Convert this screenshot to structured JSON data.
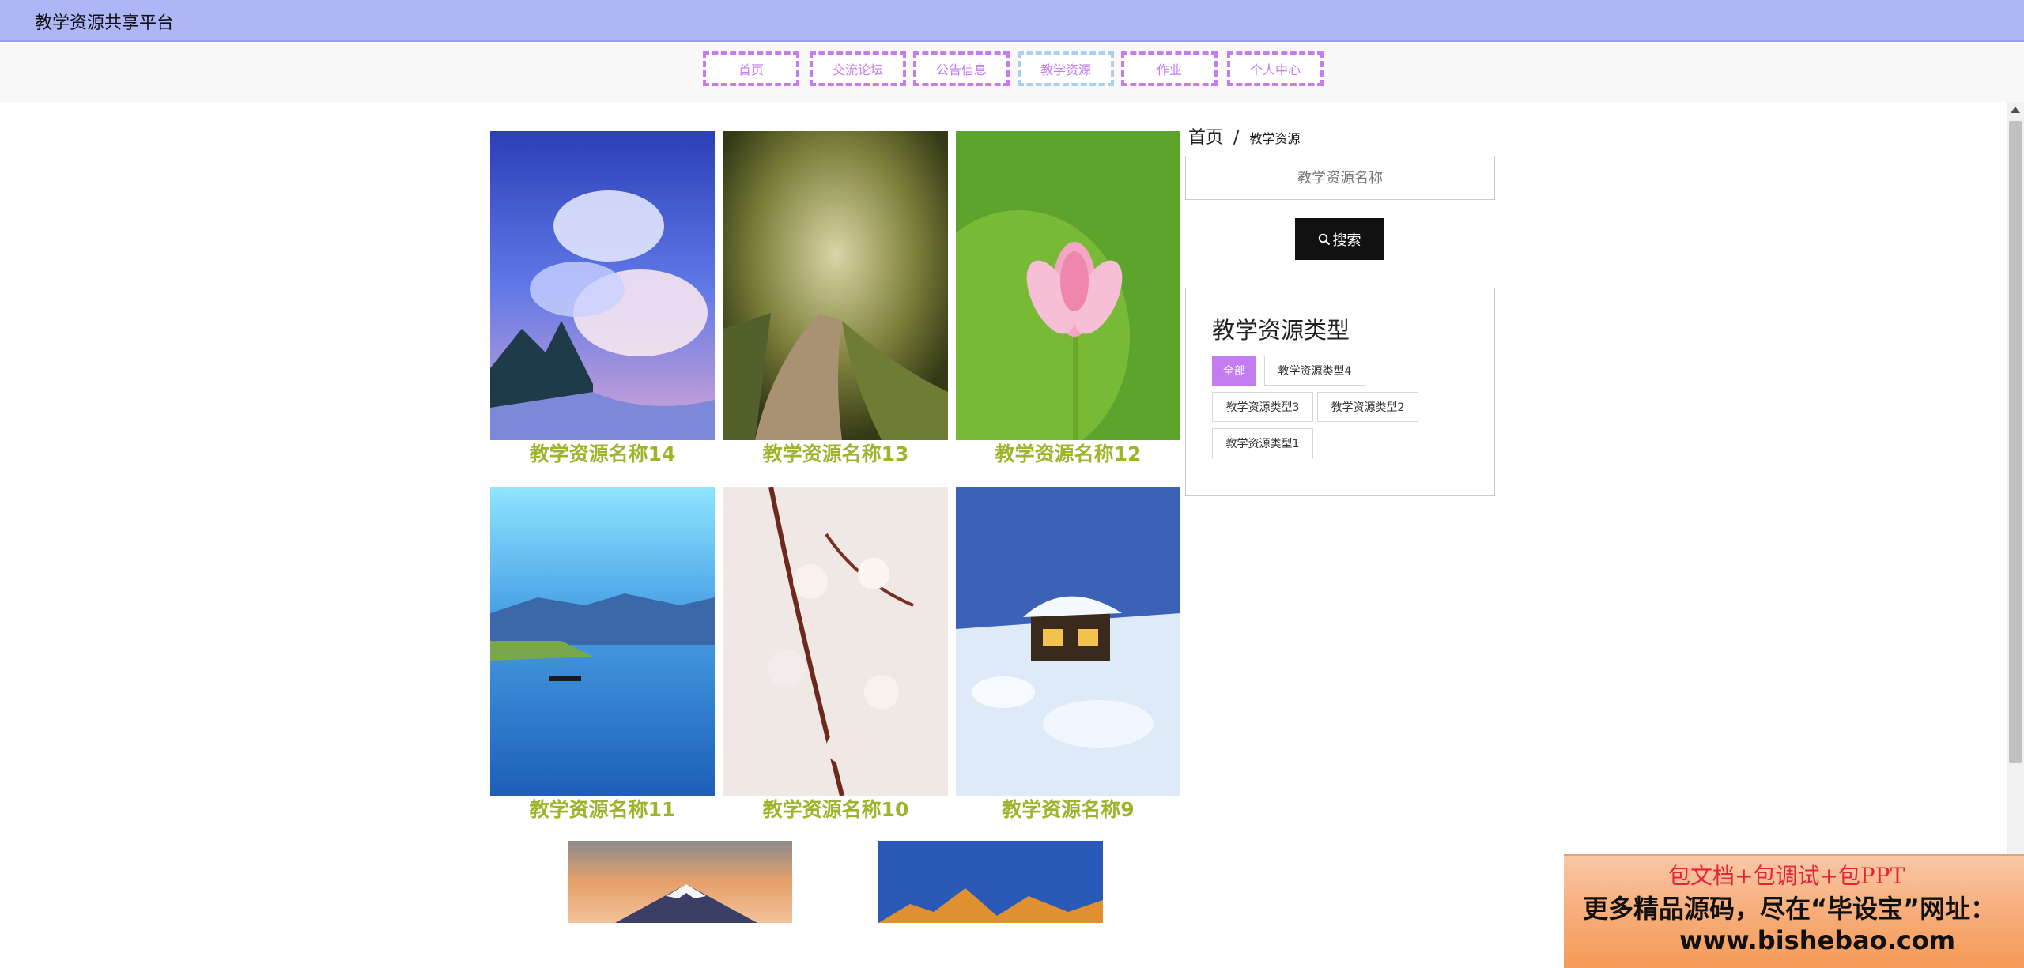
{
  "app": {
    "title": "教学资源共享平台"
  },
  "nav": {
    "items": [
      {
        "label": "首页"
      },
      {
        "label": "交流论坛"
      },
      {
        "label": "公告信息"
      },
      {
        "label": "教学资源"
      },
      {
        "label": "作业"
      },
      {
        "label": "个人中心"
      }
    ],
    "active_index": 3
  },
  "breadcrumb": {
    "home": "首页",
    "separator": "/",
    "current": "教学资源"
  },
  "search": {
    "placeholder": "教学资源名称",
    "button_label": "搜索",
    "icon": "search-icon"
  },
  "types": {
    "title": "教学资源类型",
    "items": [
      {
        "label": "全部",
        "active": true
      },
      {
        "label": "教学资源类型4"
      },
      {
        "label": "教学资源类型3"
      },
      {
        "label": "教学资源类型2"
      },
      {
        "label": "教学资源类型1"
      }
    ]
  },
  "resources": [
    {
      "name": "教学资源名称14",
      "image": "anime-sky-clouds"
    },
    {
      "name": "教学资源名称13",
      "image": "forest-path"
    },
    {
      "name": "教学资源名称12",
      "image": "pink-lotus"
    },
    {
      "name": "教学资源名称11",
      "image": "lake-mountains-boat"
    },
    {
      "name": "教学资源名称10",
      "image": "cherry-blossom-branch"
    },
    {
      "name": "教学资源名称9",
      "image": "snow-cabin-night"
    },
    {
      "name": "",
      "image": "mount-fuji-sunset"
    },
    {
      "name": "",
      "image": "golden-mountain-peaks"
    }
  ],
  "ad": {
    "line1": "包文档+包调试+包PPT",
    "line2": "更多精品源码，尽在“毕设宝”网址：",
    "line3": "www.bishebao.com"
  },
  "colors": {
    "topbar": "#aeb6f7",
    "nav_accent": "#c47df0",
    "title_green": "#9cb52c",
    "button_dark": "#111111"
  }
}
